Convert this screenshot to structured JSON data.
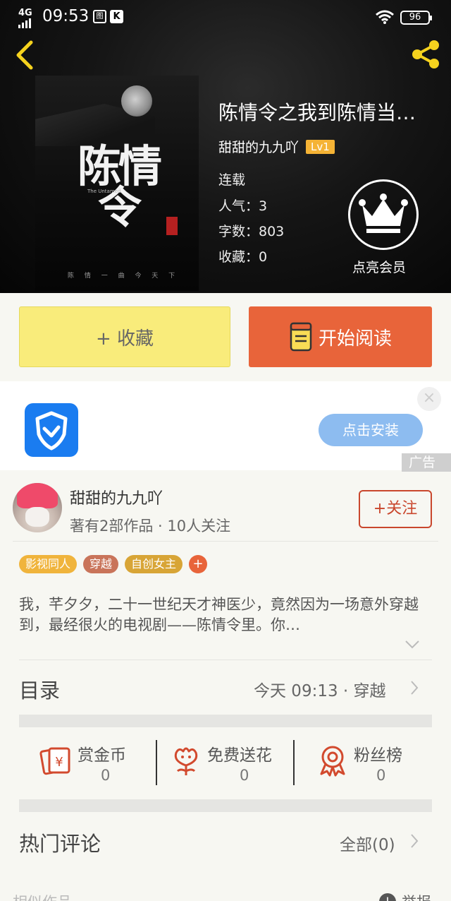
{
  "status_bar": {
    "network": "4G",
    "time": "09:53",
    "app_icon_1": "图",
    "app_icon_2": "K",
    "battery": "96"
  },
  "book": {
    "title": "陈情令之我到陈情当…",
    "author": "甜甜的九九吖",
    "level": "Lv1",
    "status": "连载",
    "popularity": "人气：3",
    "word_count": "字数：803",
    "favorites": "收藏：0",
    "cover": {
      "title": "陈情令",
      "en": "The Untamed",
      "subtitle": "陈 情 一 曲 今 天 下"
    }
  },
  "vip": {
    "label": "点亮会员"
  },
  "actions": {
    "favorite_label": "+ 收藏",
    "read_label": "开始阅读"
  },
  "ad": {
    "install_label": "点击安装",
    "close_icon": "×",
    "tag": "广告"
  },
  "author": {
    "name": "甜甜的九九吖",
    "stats": "著有2部作品 · 10人关注",
    "follow_label": "+关注"
  },
  "tags": [
    {
      "label": "影视同人",
      "color": "#f0b43c"
    },
    {
      "label": "穿越",
      "color": "#c9745a"
    },
    {
      "label": "自创女主",
      "color": "#d8a536"
    }
  ],
  "tag_more": "+",
  "description": "我，芊夕夕，二十一世纪天才神医少，竟然因为一场意外穿越到，最经很火的电视剧——陈情令里。你…",
  "catalog": {
    "title": "目录",
    "latest": "今天 09:13 · 穿越"
  },
  "stats": [
    {
      "label": "赏金币",
      "value": "0"
    },
    {
      "label": "免费送花",
      "value": "0"
    },
    {
      "label": "粉丝榜",
      "value": "0"
    }
  ],
  "comments": {
    "title": "热门评论",
    "all_label": "全部(0)"
  },
  "footer": {
    "similar": "相似作品",
    "report": "举报",
    "report_icon": "!"
  },
  "colors": {
    "accent_orange": "#e8643a",
    "fav_yellow": "#f9ec7b",
    "level_badge": "#f5b335",
    "icon_red": "#d24a2e",
    "nav_yellow": "#f5d21e"
  }
}
